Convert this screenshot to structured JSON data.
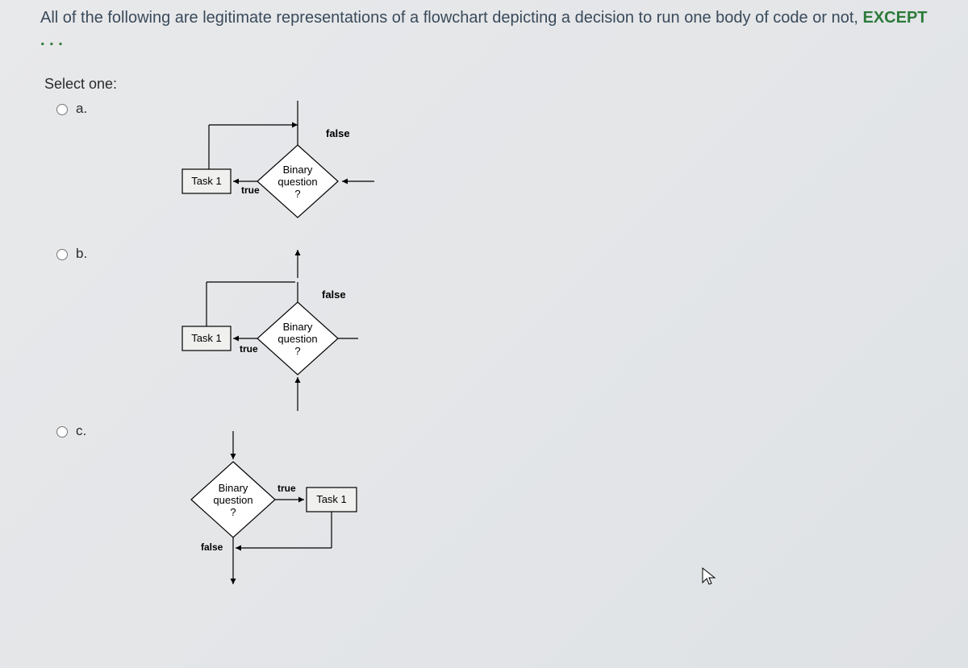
{
  "question": {
    "lead": "All of the following are legitimate representations of a flowchart depicting a decision to run one body of code or not, ",
    "except": "EXCEPT . . ."
  },
  "prompt": "Select one:",
  "options": {
    "a": {
      "label": "a."
    },
    "b": {
      "label": "b."
    },
    "c": {
      "label": "c."
    }
  },
  "flowchart": {
    "task": "Task 1",
    "decision_l1": "Binary",
    "decision_l2": "question",
    "decision_l3": "?",
    "true": "true",
    "false": "false"
  },
  "colors": {
    "text": "#2a2a2a",
    "line": "#000000",
    "box_fill": "#f0f0ee",
    "diamond_fill": "#ffffff"
  }
}
